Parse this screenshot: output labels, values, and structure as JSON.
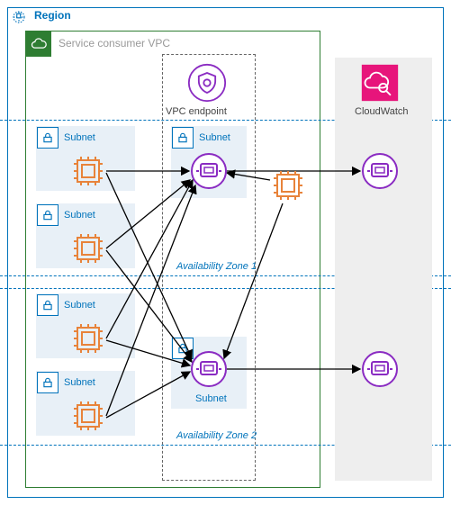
{
  "region": {
    "label": "Region"
  },
  "vpc": {
    "label": "Service consumer VPC"
  },
  "endpoint": {
    "label": "VPC endpoint"
  },
  "cloudwatch": {
    "label": "CloudWatch"
  },
  "az": {
    "one": "Availability Zone 1",
    "two": "Availability Zone 2"
  },
  "subnets": {
    "a": "Subnet",
    "b": "Subnet",
    "c": "Subnet",
    "d": "Subnet",
    "e": "Subnet",
    "f": "Subnet"
  },
  "colors": {
    "region": "#0073bb",
    "vpc": "#2e7d32",
    "chip": "#e8833a",
    "eni": "#8a2bc2",
    "cw_bg": "#e7157b"
  }
}
